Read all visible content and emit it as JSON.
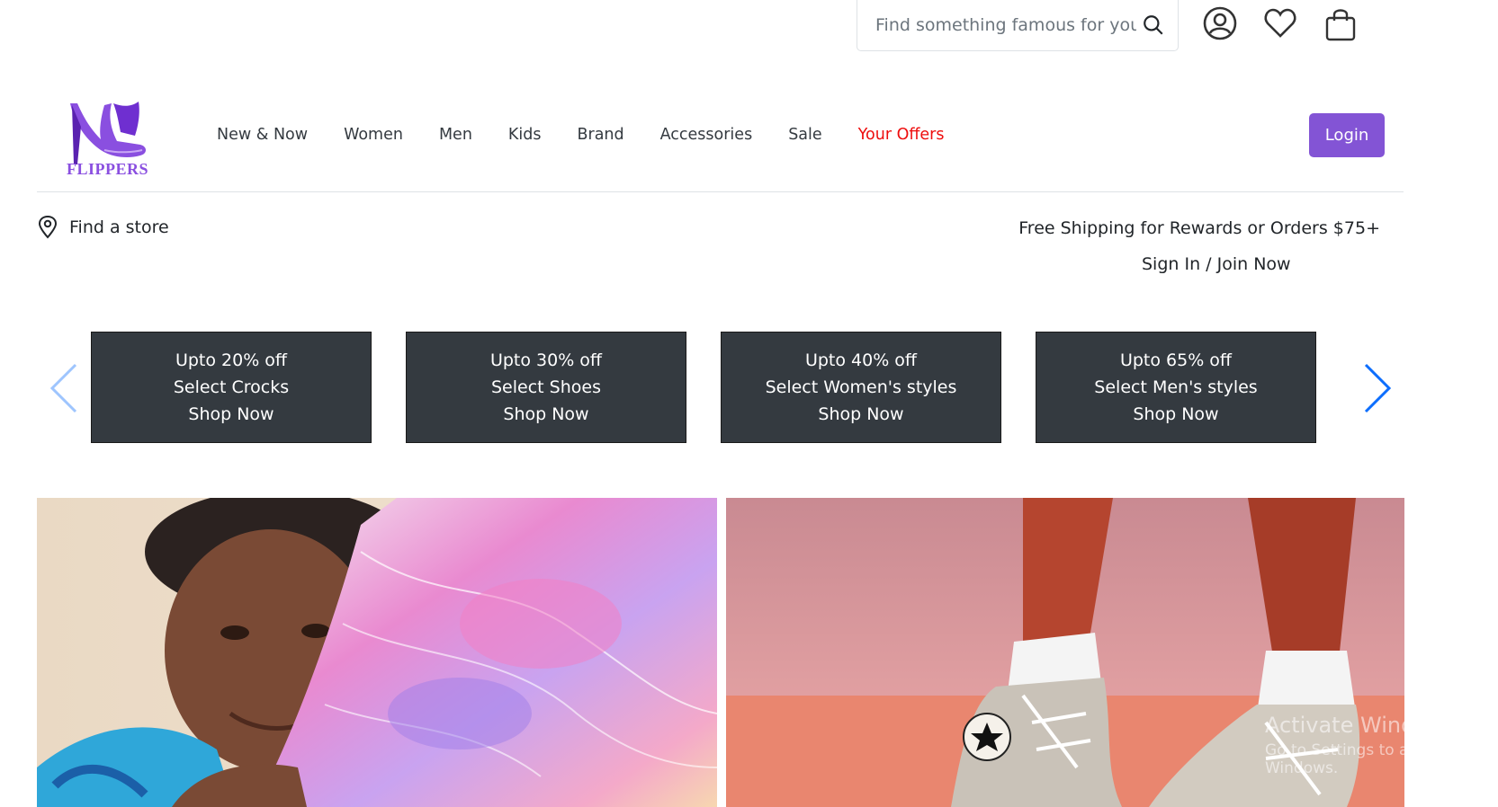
{
  "search": {
    "placeholder": "Find something famous for you"
  },
  "header_icons": [
    "search-icon",
    "account-icon",
    "heart-icon",
    "shopping-bag-icon"
  ],
  "logo": {
    "text": "FLIPPERS",
    "color": "#8a4fe0"
  },
  "nav": {
    "items": [
      {
        "label": "New & Now"
      },
      {
        "label": "Women"
      },
      {
        "label": "Men"
      },
      {
        "label": "Kids"
      },
      {
        "label": "Brand"
      },
      {
        "label": "Accessories"
      },
      {
        "label": "Sale"
      },
      {
        "label": "Your Offers"
      }
    ],
    "offers_color": "#ee0d0d"
  },
  "login": {
    "label": "Login",
    "color": "#8354d5"
  },
  "info": {
    "store_label": "Find a store",
    "shipping_text": "Free Shipping for Rewards or Orders $75+",
    "signin_text": "Sign In / Join Now"
  },
  "promos": [
    {
      "line1": "Upto 20% off",
      "line2": "Select Crocks",
      "line3": "Shop Now"
    },
    {
      "line1": "Upto 30% off",
      "line2": "Select Shoes",
      "line3": "Shop Now"
    },
    {
      "line1": "Upto 40% off",
      "line2": "Select Women's styles",
      "line3": "Shop Now"
    },
    {
      "line1": "Upto 65% off",
      "line2": "Select Men's styles",
      "line3": "Shop Now"
    }
  ],
  "promo_color": "#343a40",
  "carousel": {
    "arrow_color": "#0d6efd"
  },
  "watermark": {
    "line1": "Activate Windows",
    "line2": "Go to Settings to activate Windows."
  }
}
